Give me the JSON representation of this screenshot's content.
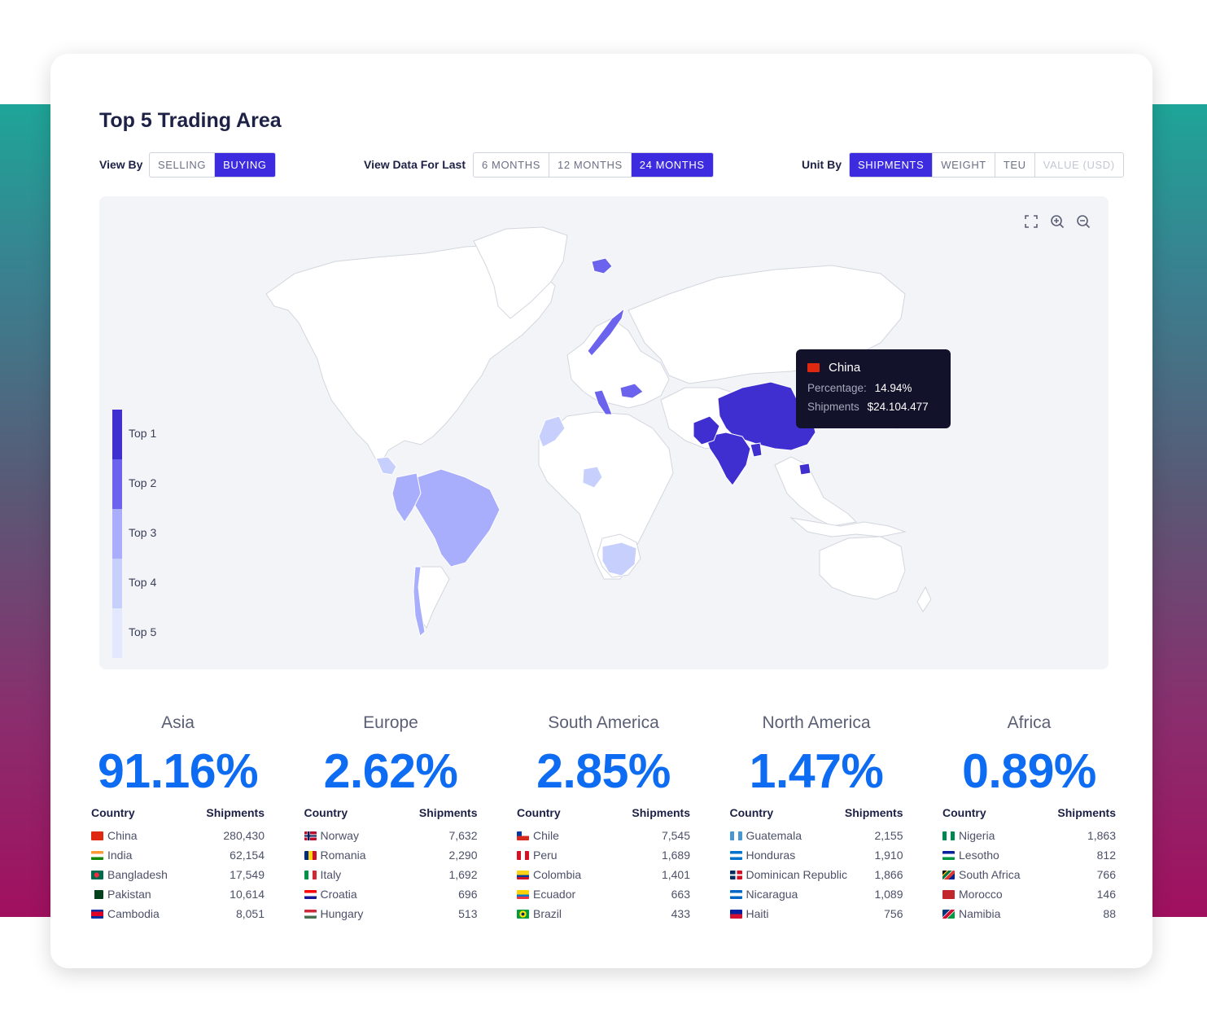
{
  "title": "Top 5 Trading Area",
  "view_by": {
    "label": "View By",
    "options": [
      {
        "label": "SELLING",
        "active": false
      },
      {
        "label": "BUYING",
        "active": true
      }
    ]
  },
  "view_data": {
    "label": "View Data For Last",
    "options": [
      {
        "label": "6 MONTHS",
        "active": false
      },
      {
        "label": "12 MONTHS",
        "active": false
      },
      {
        "label": "24 MONTHS",
        "active": true
      }
    ]
  },
  "unit_by": {
    "label": "Unit By",
    "options": [
      {
        "label": "SHIPMENTS",
        "active": true
      },
      {
        "label": "WEIGHT",
        "active": false
      },
      {
        "label": "TEU",
        "active": false
      },
      {
        "label": "VALUE (USD)",
        "active": false,
        "disabled": true
      }
    ]
  },
  "map": {
    "tools": [
      "fullscreen-icon",
      "zoom-in-icon",
      "zoom-out-icon"
    ],
    "legend": [
      {
        "label": "Top 1",
        "color": "#3f2fd0"
      },
      {
        "label": "Top 2",
        "color": "#6b63ee"
      },
      {
        "label": "Top 3",
        "color": "#a8aefb"
      },
      {
        "label": "Top 4",
        "color": "#c7d0fd"
      },
      {
        "label": "Top 5",
        "color": "#e3e8fe"
      }
    ],
    "tooltip": {
      "country": "China",
      "percentage_label": "Percentage:",
      "percentage_value": "14.94%",
      "shipments_label": "Shipments",
      "shipments_value": "$24.104.477"
    }
  },
  "regions": [
    {
      "name": "Asia",
      "percent": "91.16%",
      "col_country": "Country",
      "col_shipments": "Shipments",
      "rows": [
        {
          "country": "China",
          "shipments": "280,430",
          "flag": "china"
        },
        {
          "country": "India",
          "shipments": "62,154",
          "flag": "india"
        },
        {
          "country": "Bangladesh",
          "shipments": "17,549",
          "flag": "bangladesh"
        },
        {
          "country": "Pakistan",
          "shipments": "10,614",
          "flag": "pakistan"
        },
        {
          "country": "Cambodia",
          "shipments": "8,051",
          "flag": "cambodia"
        }
      ]
    },
    {
      "name": "Europe",
      "percent": "2.62%",
      "col_country": "Country",
      "col_shipments": "Shipments",
      "rows": [
        {
          "country": "Norway",
          "shipments": "7,632",
          "flag": "norway"
        },
        {
          "country": "Romania",
          "shipments": "2,290",
          "flag": "romania"
        },
        {
          "country": "Italy",
          "shipments": "1,692",
          "flag": "italy"
        },
        {
          "country": "Croatia",
          "shipments": "696",
          "flag": "croatia"
        },
        {
          "country": "Hungary",
          "shipments": "513",
          "flag": "hungary"
        }
      ]
    },
    {
      "name": "South America",
      "percent": "2.85%",
      "col_country": "Country",
      "col_shipments": "Shipments",
      "rows": [
        {
          "country": "Chile",
          "shipments": "7,545",
          "flag": "chile"
        },
        {
          "country": "Peru",
          "shipments": "1,689",
          "flag": "peru"
        },
        {
          "country": "Colombia",
          "shipments": "1,401",
          "flag": "colombia"
        },
        {
          "country": "Ecuador",
          "shipments": "663",
          "flag": "ecuador"
        },
        {
          "country": "Brazil",
          "shipments": "433",
          "flag": "brazil"
        }
      ]
    },
    {
      "name": "North America",
      "percent": "1.47%",
      "col_country": "Country",
      "col_shipments": "Shipments",
      "rows": [
        {
          "country": "Guatemala",
          "shipments": "2,155",
          "flag": "guatemala"
        },
        {
          "country": "Honduras",
          "shipments": "1,910",
          "flag": "honduras"
        },
        {
          "country": "Dominican Republic",
          "shipments": "1,866",
          "flag": "dominican-republic"
        },
        {
          "country": "Nicaragua",
          "shipments": "1,089",
          "flag": "nicaragua"
        },
        {
          "country": "Haiti",
          "shipments": "756",
          "flag": "haiti"
        }
      ]
    },
    {
      "name": "Africa",
      "percent": "0.89%",
      "col_country": "Country",
      "col_shipments": "Shipments",
      "rows": [
        {
          "country": "Nigeria",
          "shipments": "1,863",
          "flag": "nigeria"
        },
        {
          "country": "Lesotho",
          "shipments": "812",
          "flag": "lesotho"
        },
        {
          "country": "South Africa",
          "shipments": "766",
          "flag": "south-africa"
        },
        {
          "country": "Morocco",
          "shipments": "146",
          "flag": "morocco"
        },
        {
          "country": "Namibia",
          "shipments": "88",
          "flag": "namibia"
        }
      ]
    }
  ],
  "colors": {
    "accent": "#3d2be0",
    "percent": "#0d6cf2",
    "land": "#ffffff",
    "map_bg": "#f3f4f7"
  }
}
